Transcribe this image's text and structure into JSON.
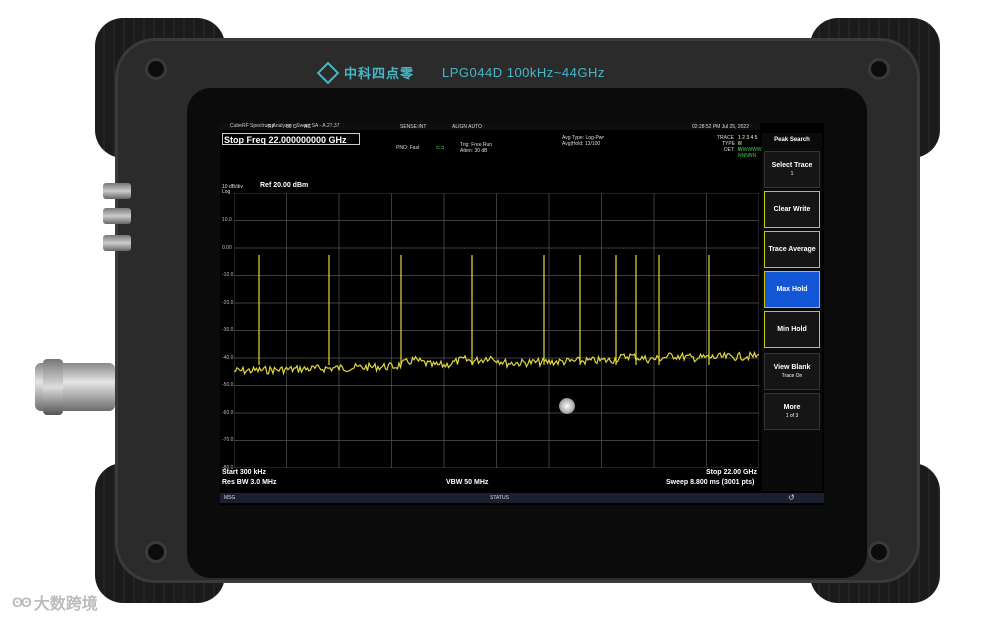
{
  "brand": {
    "logo_text": "中科四点零",
    "model": "LPG044D 100kHz~44GHz"
  },
  "window": {
    "title": "CubeRF Spectrum Analyzer - Swept SA - A.27.37"
  },
  "top_status": {
    "labels": [
      "RF",
      "50 Ω",
      "AC",
      "SENSE:INT",
      "ALIGN AUTO"
    ],
    "datetime": "02:28:52 PM Jul 25, 2022"
  },
  "measurement": {
    "active_function": "Stop Freq 22.000000000 GHz",
    "pno": "PNO: Fast",
    "trig": "Trig: Free Run",
    "atten": "Atten: 30 dB",
    "avg_type": "Avg Type: Log-Pwr",
    "avg_hold": "Avg|Hold: 13/100",
    "trace_label": "TRACE",
    "trace_nums": "1 2 3 4 5 6",
    "type_label": "TYPE",
    "type_vals": "M WWWWW",
    "det_label": "DET",
    "det_vals": "P NNNNN"
  },
  "plot": {
    "scale_label": "10 dB/div",
    "log_label": "Log",
    "ref_level": "Ref 20.00 dBm",
    "y_ticks": [
      "10.0",
      "0.00",
      "-10.0",
      "-20.0",
      "-30.0",
      "-40.0",
      "-50.0",
      "-60.0",
      "-70.0",
      "-80.0"
    ],
    "start": "Start 300 kHz",
    "res_bw": "Res BW 3.0 MHz",
    "vbw": "VBW 50 MHz",
    "stop": "Stop 22.00 GHz",
    "sweep": "Sweep  8.800 ms (3001 pts)",
    "trace_color": "#e0d840"
  },
  "softkeys": {
    "menu_title": "Peak Search",
    "items": [
      {
        "label": "Select Trace",
        "sub": "1"
      },
      {
        "label": "Clear Write",
        "sub": ""
      },
      {
        "label": "Trace Average",
        "sub": ""
      },
      {
        "label": "Max Hold",
        "sub": ""
      },
      {
        "label": "Min Hold",
        "sub": ""
      },
      {
        "label": "View Blank",
        "sub": "Trace On"
      },
      {
        "label": "More",
        "sub": "1 of 3"
      }
    ]
  },
  "statusbar": {
    "msg": "MSG",
    "status": "STATUS"
  },
  "watermark": {
    "text": "大数跨境"
  }
}
